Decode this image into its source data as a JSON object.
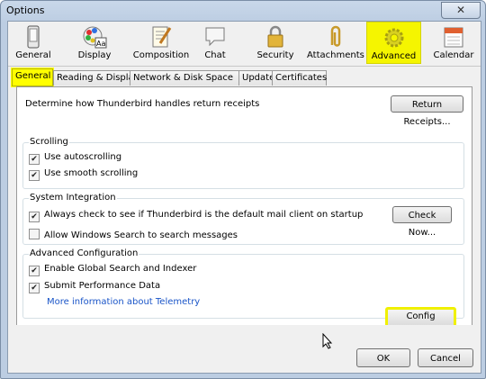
{
  "window": {
    "title": "Options",
    "close_glyph": "✕"
  },
  "toolbar": {
    "items": [
      {
        "label": "General",
        "icon": "phone-icon"
      },
      {
        "label": "Display",
        "icon": "palette-icon"
      },
      {
        "label": "Composition",
        "icon": "pen-paper-icon"
      },
      {
        "label": "Chat",
        "icon": "chat-bubble-icon"
      },
      {
        "label": "Security",
        "icon": "padlock-icon"
      },
      {
        "label": "Attachments",
        "icon": "paperclip-icon"
      },
      {
        "label": "Advanced",
        "icon": "gear-icon"
      },
      {
        "label": "Calendar",
        "icon": "calendar-icon"
      }
    ],
    "selected": "Advanced",
    "highlight_color": "#f5f500"
  },
  "tabs": [
    "General",
    "Reading & Display",
    "Network & Disk Space",
    "Update",
    "Certificates"
  ],
  "selected_tab": "General",
  "general": {
    "receipts_text": "Determine how Thunderbird handles return receipts",
    "receipts_button": "Return Receipts...",
    "scrolling": {
      "title": "Scrolling",
      "autoscroll": {
        "label": "Use autoscrolling",
        "checked": true
      },
      "smooth": {
        "label": "Use smooth scrolling",
        "checked": true
      }
    },
    "system": {
      "title": "System Integration",
      "default_client": {
        "label": "Always check to see if Thunderbird is the default mail client on startup",
        "checked": true
      },
      "check_now": "Check Now...",
      "windows_search": {
        "label": "Allow Windows Search to search messages",
        "checked": false
      }
    },
    "advanced": {
      "title": "Advanced Configuration",
      "global_search": {
        "label": "Enable Global Search and Indexer",
        "checked": true
      },
      "perf_data": {
        "label": "Submit Performance Data",
        "checked": true
      },
      "telemetry_link": "More information about Telemetry",
      "config_editor": "Config Editor..."
    }
  },
  "footer": {
    "ok": "OK",
    "cancel": "Cancel"
  },
  "check_glyph": "✔"
}
